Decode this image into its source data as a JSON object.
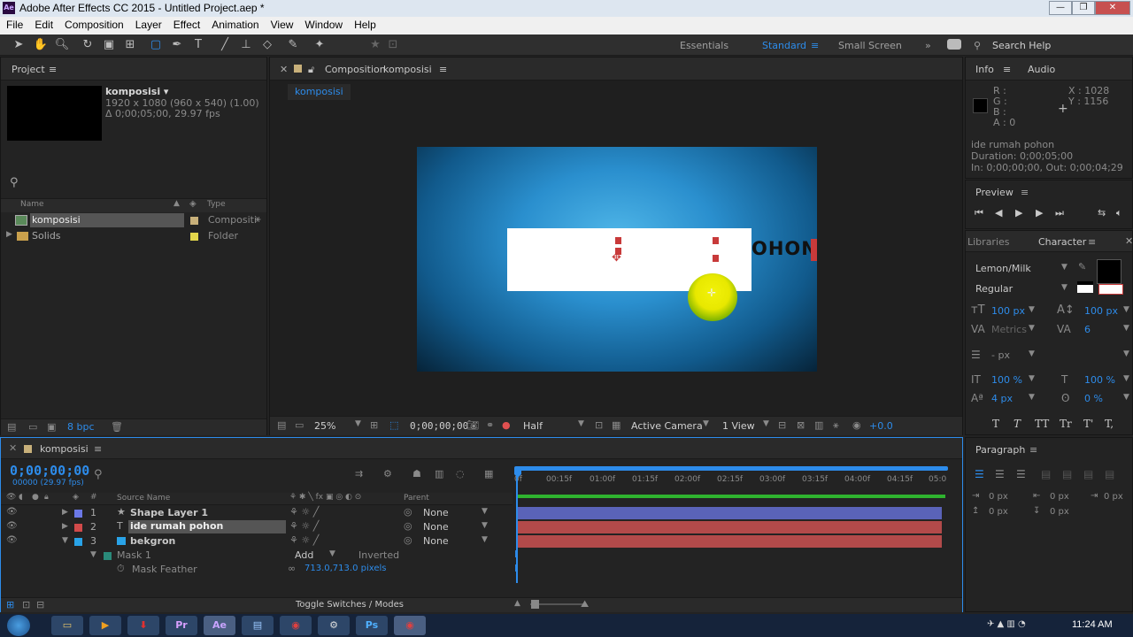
{
  "window": {
    "title": "Adobe After Effects CC 2015 - Untitled Project.aep *",
    "app_badge": "Ae"
  },
  "menu": [
    "File",
    "Edit",
    "Composition",
    "Layer",
    "Effect",
    "Animation",
    "View",
    "Window",
    "Help"
  ],
  "workspaces": {
    "essentials": "Essentials",
    "standard": "Standard",
    "small_screen": "Small Screen",
    "search": "Search Help"
  },
  "project": {
    "tab": "Project",
    "comp_name": "komposisi ▾",
    "comp_size": "1920 x 1080  (960 x 540) (1.00)",
    "comp_duration": "Δ 0;00;05;00, 29.97 fps",
    "col_name": "Name",
    "col_type": "Type",
    "items": [
      {
        "name": "komposisi",
        "type": "Compositi"
      },
      {
        "name": "Solids",
        "type": "Folder"
      }
    ],
    "bpc": "8 bpc"
  },
  "composition": {
    "tab_prefix": "Composition",
    "tab_name": "komposisi",
    "subtab": "komposisi",
    "canvas_text": "OHON",
    "zoom": "25%",
    "timecode": "0;00;00;00",
    "resolution": "Half",
    "camera": "Active Camera",
    "views": "1 View",
    "exposure": "+0.0"
  },
  "info": {
    "tab": "Info",
    "tab2": "Audio",
    "r": "R :",
    "g": "G :",
    "b": "B :",
    "a": "A : 0",
    "x": "X : 1028",
    "y": "Y : 1156",
    "layer": "ide rumah pohon",
    "duration": "Duration: 0;00;05;00",
    "inout": "In: 0;00;00;00, Out: 0;00;04;29"
  },
  "preview": {
    "tab": "Preview"
  },
  "character": {
    "tab1": "Libraries",
    "tab2": "Character",
    "font": "Lemon/Milk",
    "style": "Regular",
    "size": "100 px",
    "leading": "100 px",
    "kerning": "Metrics",
    "tracking": "6",
    "stroke": "- px",
    "vscale": "100 %",
    "hscale": "100 %",
    "baseline": "4 px",
    "tsume": "0 %",
    "fx_buttons": [
      "T",
      "T",
      "TT",
      "Tr",
      "T'",
      "T,"
    ]
  },
  "paragraph": {
    "tab": "Paragraph",
    "indent1": "0 px",
    "indent2": "0 px",
    "indent3": "0 px",
    "space1": "0 px",
    "space2": "0 px"
  },
  "timeline": {
    "tab": "komposisi",
    "timecode": "0;00;00;00",
    "frames": "00000 (29.97 fps)",
    "col_source": "Source Name",
    "col_parent": "Parent",
    "ruler": [
      "0f",
      "00:15f",
      "01:00f",
      "01:15f",
      "02:00f",
      "02:15f",
      "03:00f",
      "03:15f",
      "04:00f",
      "04:15f",
      "05:0"
    ],
    "layers": [
      {
        "num": "1",
        "name": "Shape Layer 1",
        "parent": "None",
        "color": "#6b78e6",
        "bar": "#5a63b8"
      },
      {
        "num": "2",
        "name": "ide rumah pohon",
        "parent": "None",
        "color": "#d14a4a",
        "bar": "#b24a4a"
      },
      {
        "num": "3",
        "name": "bekgron",
        "parent": "None",
        "color": "#29a3e8",
        "bar": "#b24a4a"
      }
    ],
    "mask": "Mask 1",
    "mask_mode": "Add",
    "mask_inverted": "Inverted",
    "mask_feather": "Mask Feather",
    "mask_feather_value": "713.0,713.0 pixels",
    "toggle": "Toggle Switches / Modes"
  },
  "taskbar": {
    "clock": "11:24 AM"
  }
}
